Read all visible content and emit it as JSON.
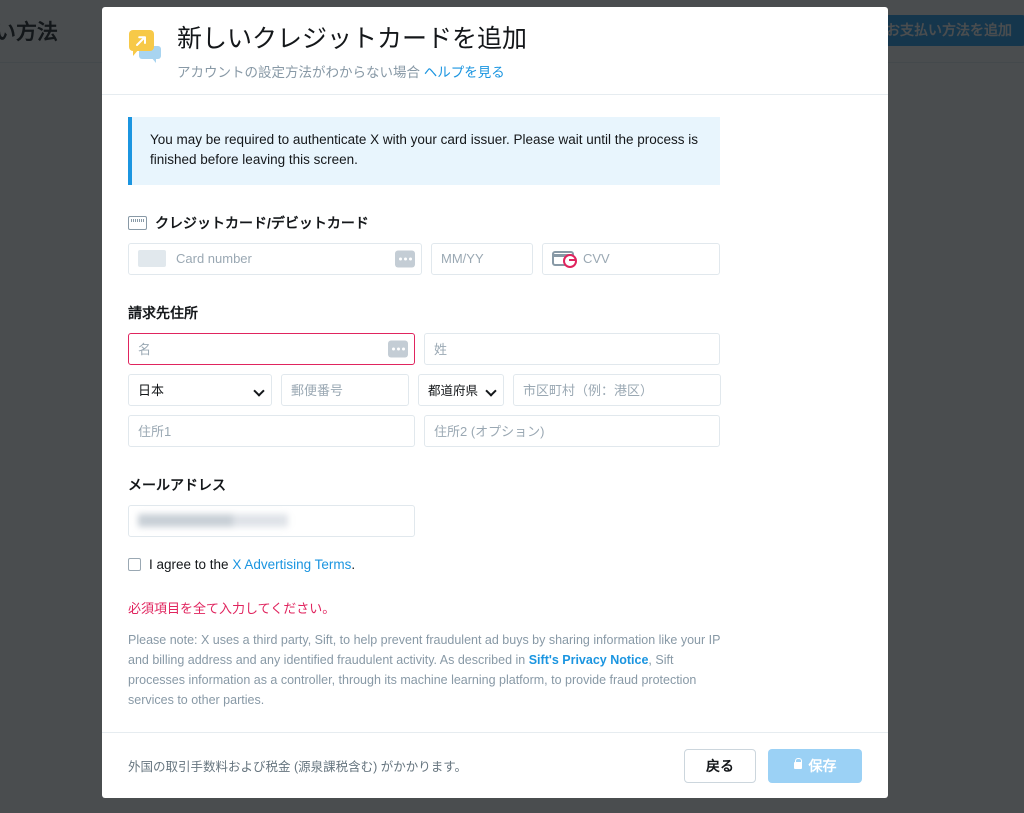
{
  "background": {
    "page_title": "払い方法",
    "add_button_label": "しいお支払い方法を追加"
  },
  "modal": {
    "icon": "speech-bubble-arrow-icon",
    "title": "新しいクレジットカードを追加",
    "subtitle_text": "アカウントの設定方法がわからない場合",
    "subtitle_link": "ヘルプを見る",
    "info_banner": "You may be required to authenticate X with your card issuer. Please wait until the process is finished before leaving this screen.",
    "card_section": {
      "icon": "credit-card-icon",
      "title": "クレジットカード/デビットカード",
      "card_number_placeholder": "Card number",
      "expiry_placeholder": "MM/YY",
      "cvv_placeholder": "CVV"
    },
    "billing_section": {
      "title": "請求先住所",
      "first_name_placeholder": "名",
      "last_name_placeholder": "姓",
      "country_value": "日本",
      "postal_placeholder": "郵便番号",
      "prefecture_value": "都道府県",
      "city_placeholder": "市区町村（例：港区）",
      "address1_placeholder": "住所1",
      "address2_placeholder": "住所2 (オプション)"
    },
    "email_section": {
      "title": "メールアドレス",
      "value": ""
    },
    "agree": {
      "text_before": "I agree to the",
      "link": "X Advertising Terms",
      "text_after": "."
    },
    "error_message": "必須項目を全て入力してください。",
    "legal": {
      "part1": "Please note: X uses a third party, Sift, to help prevent fraudulent ad buys by sharing information like your IP and billing address and any identified fraudulent activity. As described in ",
      "link": "Sift's Privacy Notice",
      "part2": ", Sift processes information as a controller, through its machine learning platform, to provide fraud protection services to other parties."
    },
    "footer": {
      "note": "外国の取引手数料および税金 (源泉課税含む) がかかります。",
      "back_label": "戻る",
      "save_label": "保存"
    }
  },
  "colors": {
    "accent": "#1b95e0",
    "error": "#e0245e",
    "banner_bg": "#e8f5fd",
    "icon_yellow": "#f7c948",
    "save_disabled": "#9bd1f5"
  }
}
